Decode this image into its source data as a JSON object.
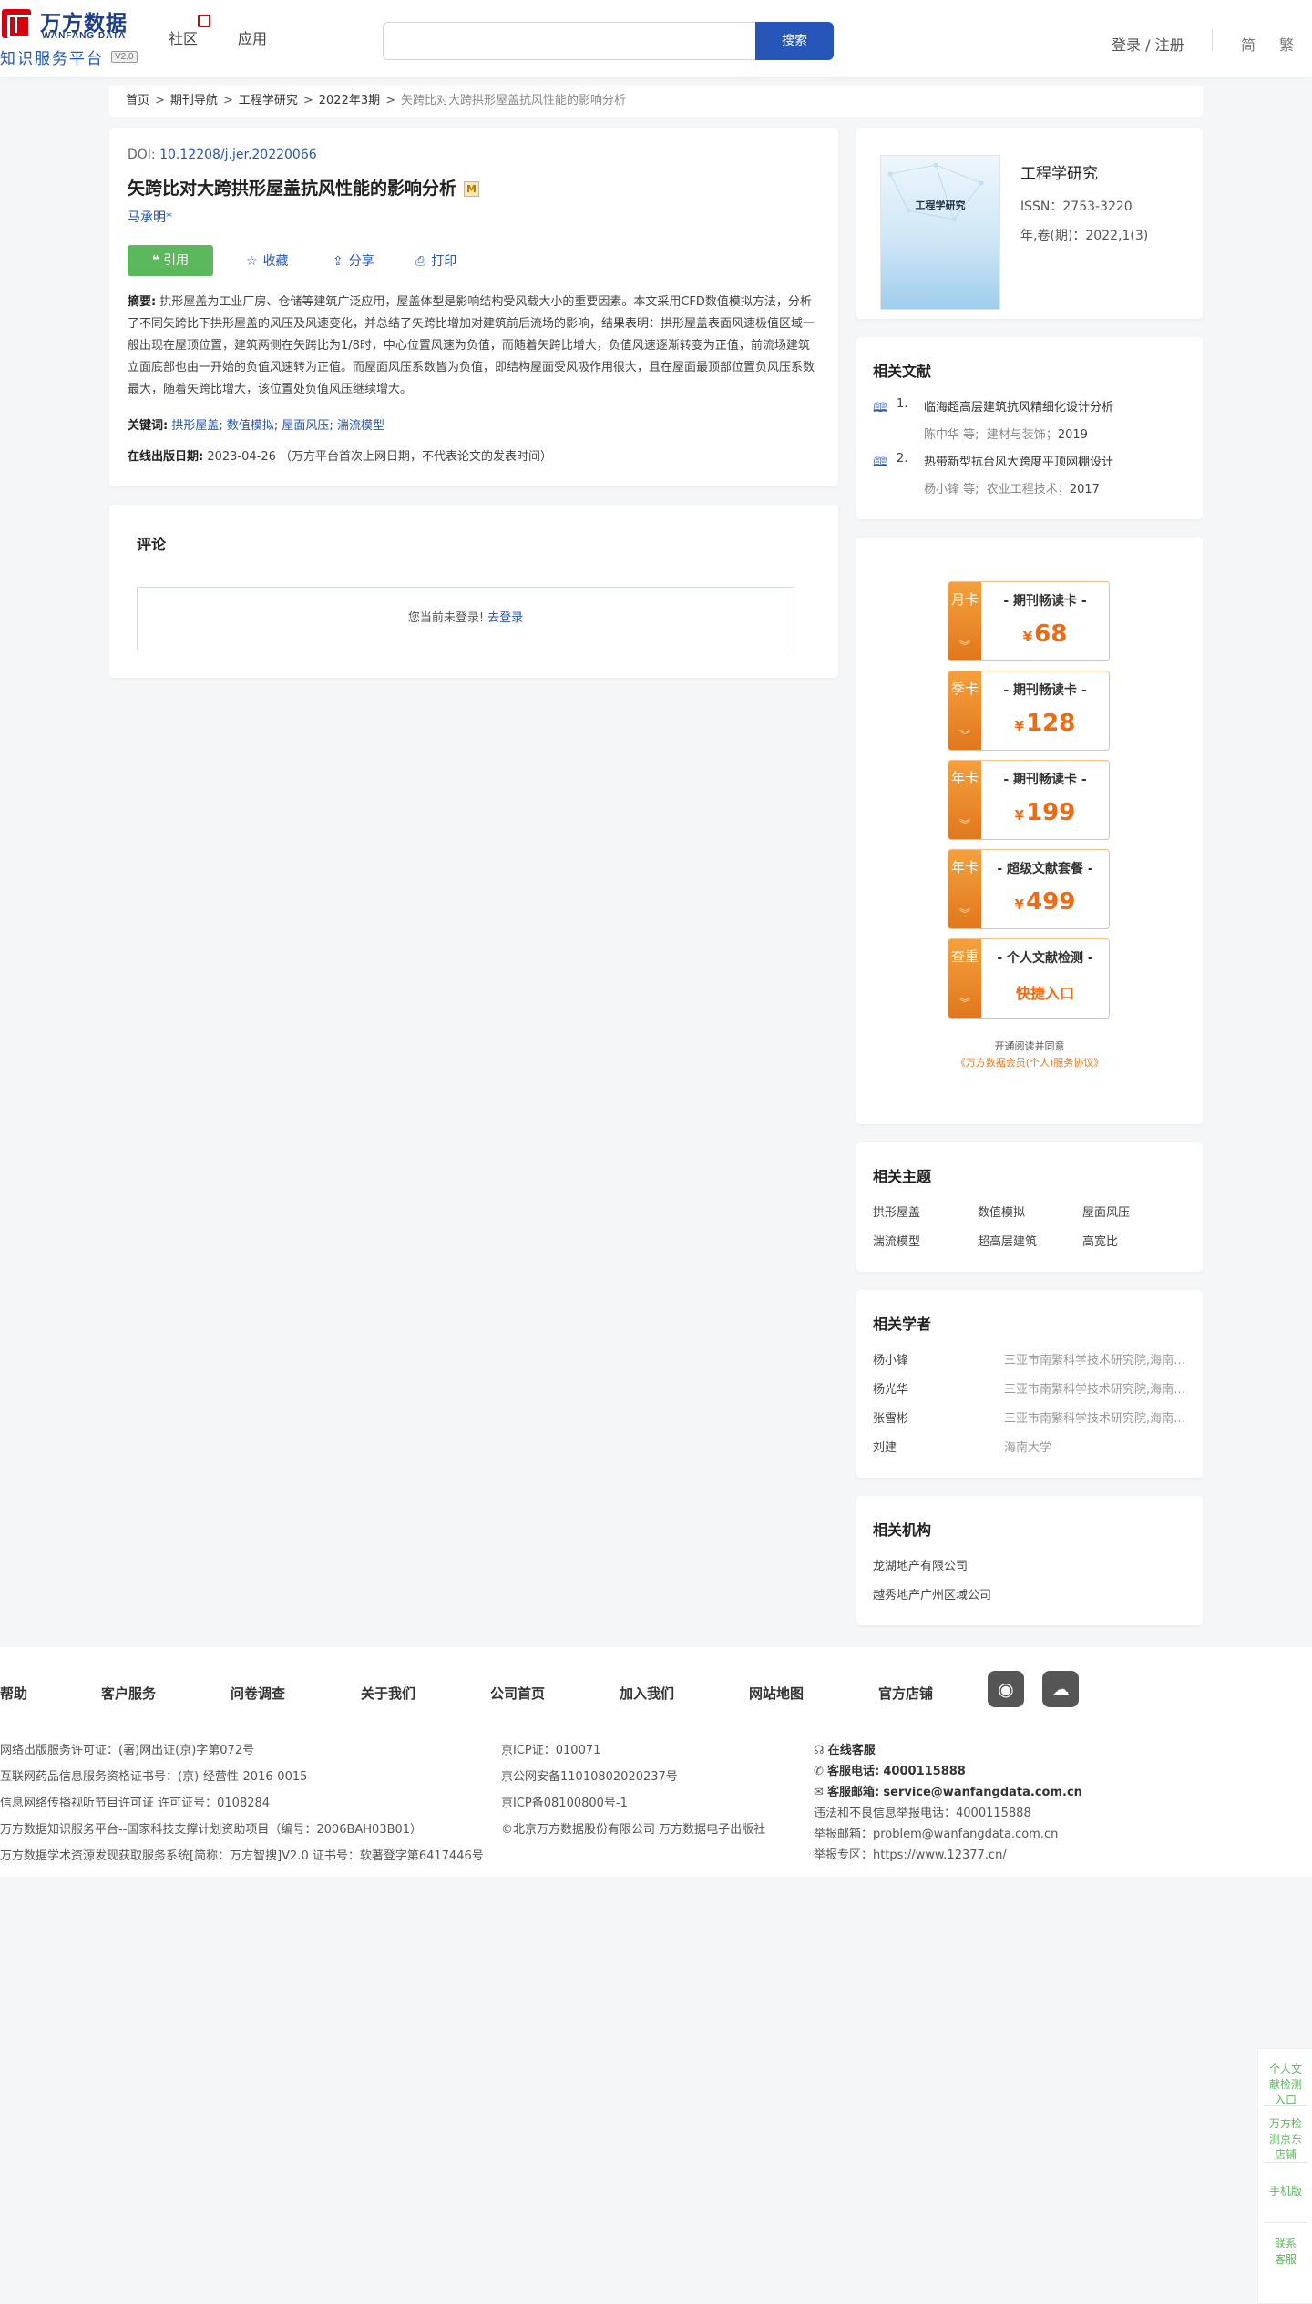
{
  "header": {
    "logo_cn": "万方数据",
    "logo_en": "WANFANG DATA",
    "logo_sub": "知识服务平台",
    "logo_ver": "V2.0",
    "nav": [
      "社区",
      "应用"
    ],
    "search_placeholder": "",
    "search_btn": "搜索",
    "login": "登录 / 注册",
    "lang_simplified": "简",
    "lang_traditional": "繁"
  },
  "breadcrumb": [
    "首页",
    "期刊导航",
    "工程学研究",
    "2022年3期",
    "矢跨比对大跨拱形屋盖抗风性能的影响分析"
  ],
  "article": {
    "doi_label": "DOI:",
    "doi": "10.12208/j.jer.20220066",
    "title": "矢跨比对大跨拱形屋盖抗风性能的影响分析",
    "badge": "M",
    "author": "马承明*",
    "actions": {
      "cite": "引用",
      "favorite": "收藏",
      "share": "分享",
      "print": "打印"
    },
    "abstract_label": "摘要:",
    "abstract": "拱形屋盖为工业厂房、仓储等建筑广泛应用，屋盖体型是影响结构受风载大小的重要因素。本文采用CFD数值模拟方法，分析了不同矢跨比下拱形屋盖的风压及风速变化，并总结了矢跨比增加对建筑前后流场的影响，结果表明：拱形屋盖表面风速极值区域一般出现在屋顶位置，建筑两侧在矢跨比为1/8时，中心位置风速为负值，而随着矢跨比增大，负值风速逐渐转变为正值，前流场建筑立面底部也由一开始的负值风速转为正值。而屋面风压系数皆为负值，即结构屋面受风吸作用很大，且在屋面最顶部位置负风压系数最大，随着矢跨比增大，该位置处负值风压继续增大。",
    "keywords_label": "关键词:",
    "keywords": [
      "拱形屋盖",
      "数值模拟",
      "屋面风压",
      "湍流模型"
    ],
    "pubdate_label": "在线出版日期:",
    "pubdate": "2023-04-26",
    "pubdate_note": "（万方平台首次上网日期，不代表论文的发表时间）"
  },
  "comment": {
    "heading": "评论",
    "not_logged": "您当前未登录!",
    "login_link": "去登录"
  },
  "journal": {
    "cover_title": "工程学研究",
    "name": "工程学研究",
    "issn": "ISSN：2753-3220",
    "volume": "年,卷(期)：2022,1(3)"
  },
  "related_docs": {
    "heading": "相关文献",
    "items": [
      {
        "num": "1.",
        "title": "临海超高层建筑抗风精细化设计分析",
        "authors": "陈中华  等;",
        "source": "建材与装饰",
        "year": "2019"
      },
      {
        "num": "2.",
        "title": "热带新型抗台风大跨度平顶网棚设计",
        "authors": "杨小锋  等;",
        "source": "农业工程技术",
        "year": "2017"
      }
    ]
  },
  "vip": {
    "cards": [
      {
        "side": "月卡",
        "title": "- 期刊畅读卡 -",
        "price": "68"
      },
      {
        "side": "季卡",
        "title": "- 期刊畅读卡 -",
        "price": "128"
      },
      {
        "side": "年卡",
        "title": "- 期刊畅读卡 -",
        "price": "199"
      },
      {
        "side": "年卡",
        "title": "- 超级文献套餐 -",
        "price": "499"
      },
      {
        "side": "查重",
        "title": "- 个人文献检测 -",
        "action": "快捷入口"
      }
    ],
    "currency": "¥",
    "agree_line1": "开通阅读并同意",
    "agree_line2": "《万方数据会员(个人)服务协议》"
  },
  "topics": {
    "heading": "相关主题",
    "items": [
      "拱形屋盖",
      "数值模拟",
      "屋面风压",
      "湍流模型",
      "超高层建筑",
      "高宽比"
    ]
  },
  "scholars": {
    "heading": "相关学者",
    "items": [
      {
        "name": "杨小锋",
        "org": "三亚市南繁科学技术研究院,海南省三亚市"
      },
      {
        "name": "杨光华",
        "org": "三亚市南繁科学技术研究院,海南省三亚市"
      },
      {
        "name": "张雪彬",
        "org": "三亚市南繁科学技术研究院,海南省三亚市"
      },
      {
        "name": "刘建",
        "org": "海南大学"
      }
    ]
  },
  "institutions": {
    "heading": "相关机构",
    "items": [
      "龙湖地产有限公司",
      "越秀地产广州区域公司"
    ]
  },
  "footer": {
    "nav": [
      "帮助",
      "客户服务",
      "问卷调查",
      "关于我们",
      "公司首页",
      "加入我们",
      "网站地图",
      "官方店铺"
    ],
    "col1": [
      "网络出版服务许可证：(署)网出证(京)字第072号",
      "互联网药品信息服务资格证书号：(京)-经营性-2016-0015",
      "信息网络传播视听节目许可证 许可证号：0108284",
      "万方数据知识服务平台--国家科技支撑计划资助项目（编号：2006BAH03B01）",
      "万方数据学术资源发现获取服务系统[简称：万方智搜]V2.0 证书号：软著登字第6417446号"
    ],
    "col2": [
      "京ICP证：010071",
      "京公网安备11010802020237号",
      "京ICP备08100800号-1",
      "©北京万方数据股份有限公司 万方数据电子出版社"
    ],
    "col3": {
      "online": "在线客服",
      "phone_label": "客服电话:",
      "phone": "4000115888",
      "email_label": "客服邮箱:",
      "email": "service@wanfangdata.com.cn",
      "report_phone": "违法和不良信息举报电话：4000115888",
      "report_email": "举报邮箱：problem@wanfangdata.com.cn",
      "report_site": "举报专区：https://www.12377.cn/"
    }
  },
  "float_bar": [
    "个人文献检测入口",
    "万方检测京东店铺",
    "手机版",
    "联系客服"
  ]
}
